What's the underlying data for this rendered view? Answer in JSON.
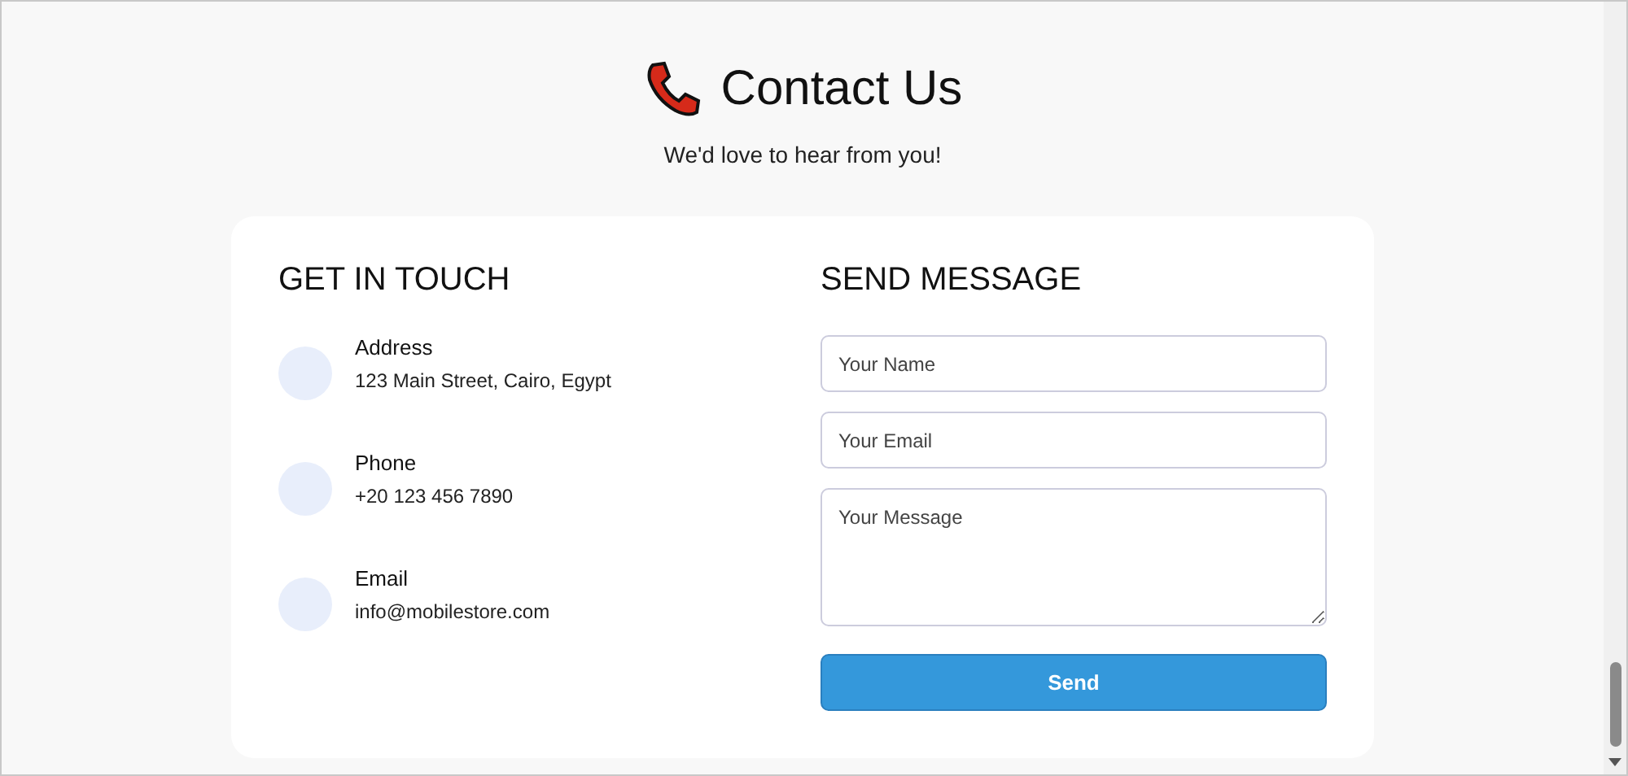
{
  "header": {
    "title": "Contact Us",
    "subtitle": "We'd love to hear from you!"
  },
  "get_in_touch": {
    "heading": "GET IN TOUCH",
    "items": [
      {
        "label": "Address",
        "value": "123 Main Street, Cairo, Egypt"
      },
      {
        "label": "Phone",
        "value": "+20 123 456 7890"
      },
      {
        "label": "Email",
        "value": "info@mobilestore.com"
      }
    ]
  },
  "send_message": {
    "heading": "SEND MESSAGE",
    "fields": [
      {
        "kind": "input",
        "placeholder": "Your Name"
      },
      {
        "kind": "input",
        "placeholder": "Your Email"
      },
      {
        "kind": "textarea",
        "placeholder": "Your Message"
      }
    ],
    "button": "Send"
  }
}
